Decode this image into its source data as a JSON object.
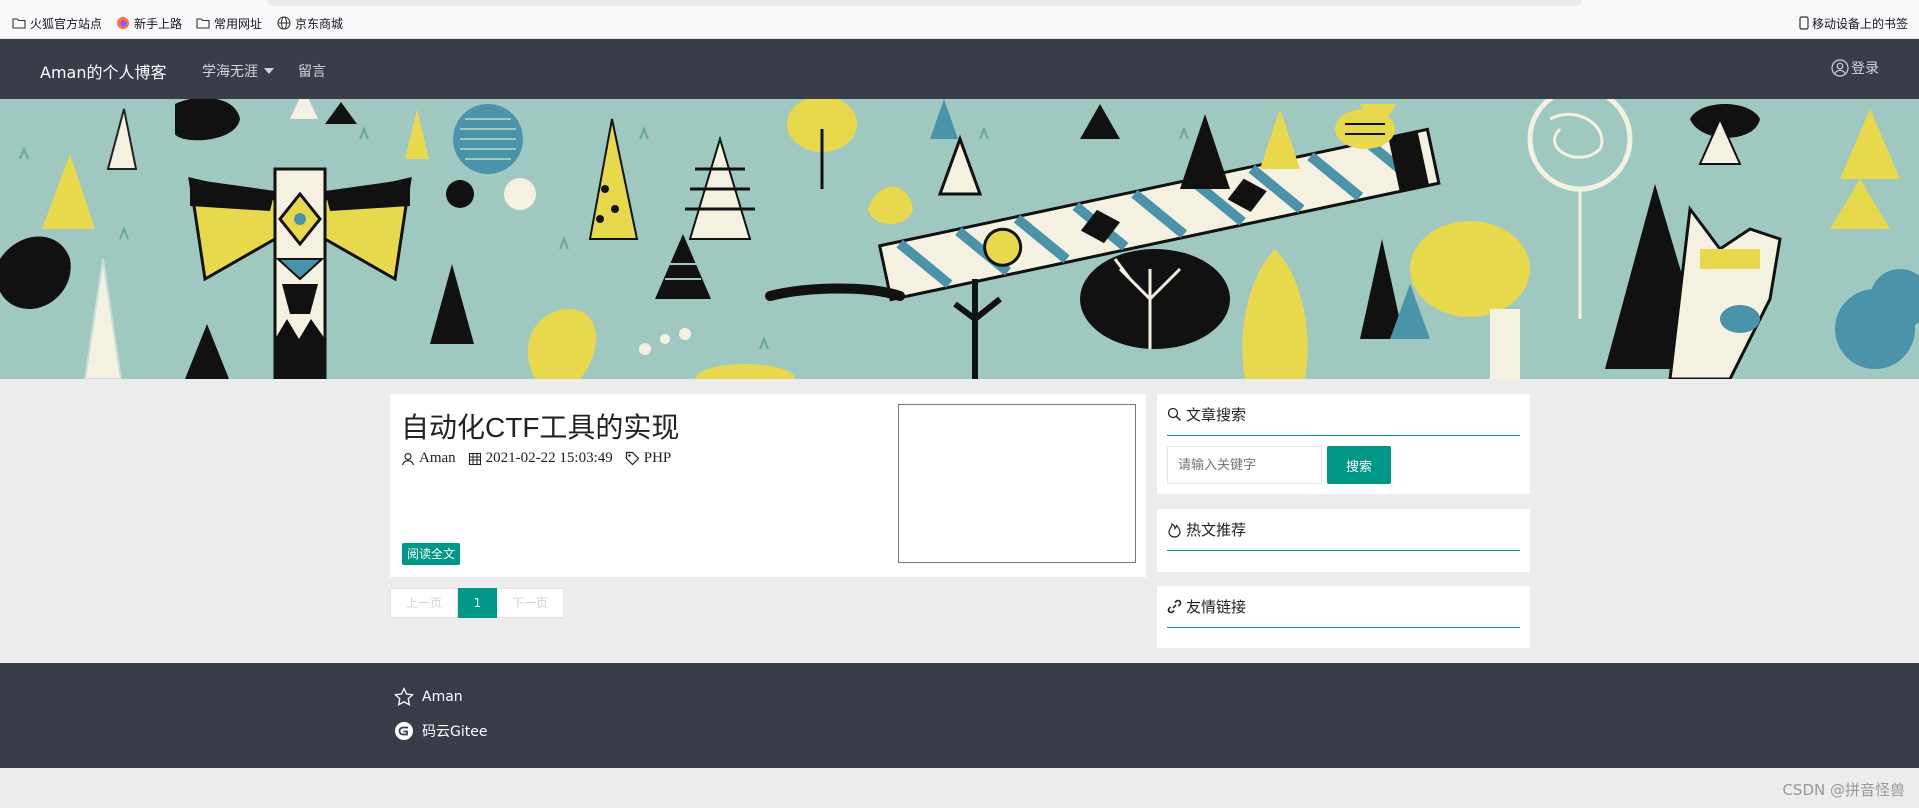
{
  "bookmarks": {
    "items": [
      {
        "label": "火狐官方站点",
        "icon": "folder-icon"
      },
      {
        "label": "新手上路",
        "icon": "firefox-icon"
      },
      {
        "label": "常用网址",
        "icon": "folder-icon"
      },
      {
        "label": "京东商城",
        "icon": "globe-icon"
      }
    ],
    "mobile": {
      "label": "移动设备上的书签",
      "icon": "mobile-icon"
    }
  },
  "navbar": {
    "brand": "Aman的个人博客",
    "menu": [
      {
        "label": "学海无涯",
        "has_dropdown": true
      },
      {
        "label": "留言",
        "has_dropdown": false
      }
    ],
    "login": "登录"
  },
  "article": {
    "title": "自动化CTF工具的实现",
    "author": "Aman",
    "date": "2021-02-22 15:03:49",
    "tag": "PHP",
    "read_more": "阅读全文"
  },
  "pager": {
    "prev": "上一页",
    "current": "1",
    "next": "下一页"
  },
  "sidebar": {
    "search": {
      "title": "文章搜索",
      "placeholder": "请输入关键字",
      "button": "搜索"
    },
    "hot": {
      "title": "热文推荐"
    },
    "links": {
      "title": "友情链接"
    }
  },
  "footer": {
    "links": [
      {
        "label": "Aman",
        "icon": "star-icon"
      },
      {
        "label": "码云Gitee",
        "icon": "gitee-icon"
      }
    ]
  },
  "watermark": "CSDN @拼音怪兽",
  "colors": {
    "navbar": "#393d49",
    "accent": "#009688",
    "banner": "#9fc9c0",
    "page_bg": "#ececec"
  }
}
